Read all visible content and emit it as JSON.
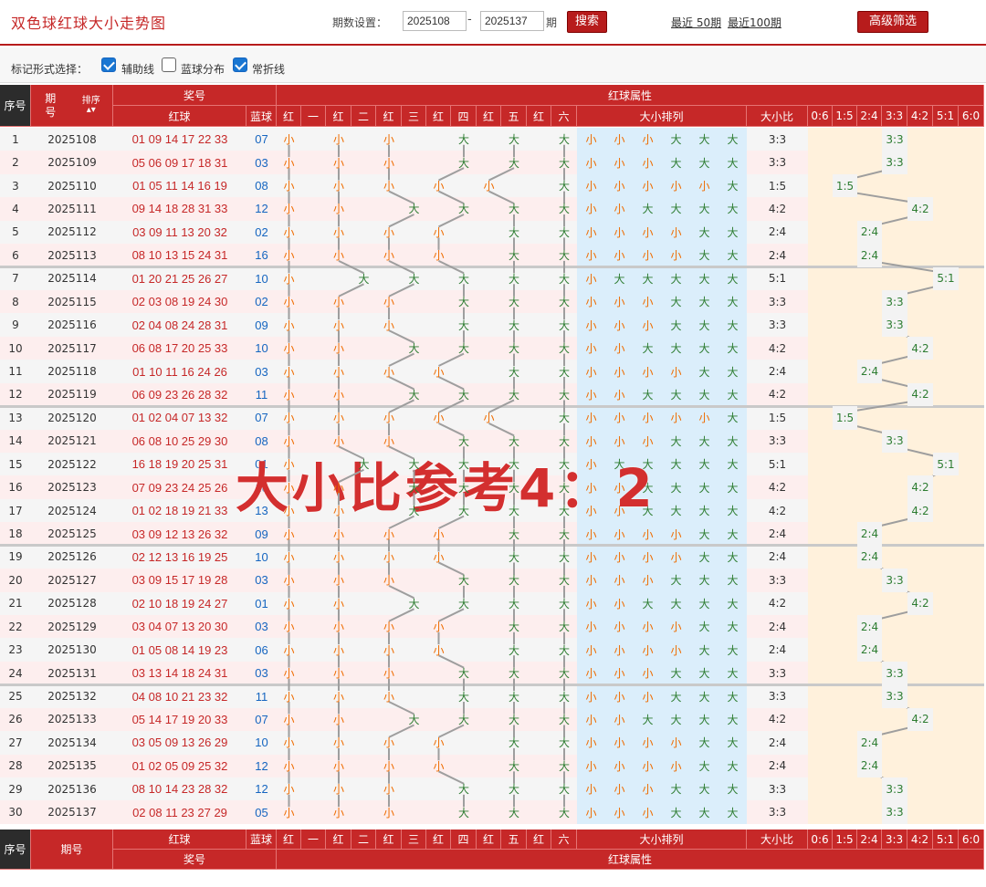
{
  "header": {
    "title": "双色球红球大小走势图",
    "period_setting_label": "期数设置：",
    "period_from": "2025108",
    "period_to": "2025137",
    "dash": "-",
    "period_unit": "期",
    "search_label": "搜索",
    "recent_50_label": "最近 50期",
    "recent_100_label": "最近100期",
    "advanced_filter_label": "高级筛选"
  },
  "mark_options": {
    "label": "标记形式选择：",
    "options": [
      {
        "label": "辅助线",
        "checked": true
      },
      {
        "label": "蓝球分布",
        "checked": false
      },
      {
        "label": "常折线",
        "checked": true
      }
    ]
  },
  "table_header": {
    "seq": "序号",
    "issue": "期号",
    "sort": "排序",
    "prize_no": "奖号",
    "red_ball": "红球",
    "blue_ball": "蓝球",
    "red_attr": "红球属性",
    "positions": [
      "红",
      "一",
      "红",
      "二",
      "红",
      "三",
      "红",
      "四",
      "红",
      "五",
      "红",
      "六"
    ],
    "size_arrangement": "大小排列",
    "size_ratio": "大小比",
    "ratio_columns": [
      "0:6",
      "1:5",
      "2:4",
      "3:3",
      "4:2",
      "5:1",
      "6:0"
    ]
  },
  "labels": {
    "small": "小",
    "big": "大"
  },
  "rows": [
    {
      "seq": "1",
      "issue": "2025108",
      "red": "01 09 14 17 22 33",
      "blue": "07",
      "pattern": "SSSBBB",
      "ratio": "3:3"
    },
    {
      "seq": "2",
      "issue": "2025109",
      "red": "05 06 09 17 18 31",
      "blue": "03",
      "pattern": "SSSBBB",
      "ratio": "3:3"
    },
    {
      "seq": "3",
      "issue": "2025110",
      "red": "01 05 11 14 16 19",
      "blue": "08",
      "pattern": "SSSSSB",
      "ratio": "1:5"
    },
    {
      "seq": "4",
      "issue": "2025111",
      "red": "09 14 18 28 31 33",
      "blue": "12",
      "pattern": "SSBBBB",
      "ratio": "4:2"
    },
    {
      "seq": "5",
      "issue": "2025112",
      "red": "03 09 11 13 20 32",
      "blue": "02",
      "pattern": "SSSSBB",
      "ratio": "2:4"
    },
    {
      "seq": "6",
      "issue": "2025113",
      "red": "08 10 13 15 24 31",
      "blue": "16",
      "pattern": "SSSSBB",
      "ratio": "2:4"
    },
    {
      "seq": "7",
      "issue": "2025114",
      "red": "01 20 21 25 26 27",
      "blue": "10",
      "pattern": "SBBBBB",
      "ratio": "5:1"
    },
    {
      "seq": "8",
      "issue": "2025115",
      "red": "02 03 08 19 24 30",
      "blue": "02",
      "pattern": "SSSBBB",
      "ratio": "3:3"
    },
    {
      "seq": "9",
      "issue": "2025116",
      "red": "02 04 08 24 28 31",
      "blue": "09",
      "pattern": "SSSBBB",
      "ratio": "3:3"
    },
    {
      "seq": "10",
      "issue": "2025117",
      "red": "06 08 17 20 25 33",
      "blue": "10",
      "pattern": "SSBBBB",
      "ratio": "4:2"
    },
    {
      "seq": "11",
      "issue": "2025118",
      "red": "01 10 11 16 24 26",
      "blue": "03",
      "pattern": "SSSSBB",
      "ratio": "2:4"
    },
    {
      "seq": "12",
      "issue": "2025119",
      "red": "06 09 23 26 28 32",
      "blue": "11",
      "pattern": "SSBBBB",
      "ratio": "4:2"
    },
    {
      "seq": "13",
      "issue": "2025120",
      "red": "01 02 04 07 13 32",
      "blue": "07",
      "pattern": "SSSSSB",
      "ratio": "1:5"
    },
    {
      "seq": "14",
      "issue": "2025121",
      "red": "06 08 10 25 29 30",
      "blue": "08",
      "pattern": "SSSBBB",
      "ratio": "3:3"
    },
    {
      "seq": "15",
      "issue": "2025122",
      "red": "16 18 19 20 25 31",
      "blue": "01",
      "pattern": "SBBBBB",
      "ratio": "5:1"
    },
    {
      "seq": "16",
      "issue": "2025123",
      "red": "07 09 23 24 25 26",
      "blue": "10",
      "pattern": "SSBBBB",
      "ratio": "4:2"
    },
    {
      "seq": "17",
      "issue": "2025124",
      "red": "01 02 18 19 21 33",
      "blue": "13",
      "pattern": "SSBBBB",
      "ratio": "4:2"
    },
    {
      "seq": "18",
      "issue": "2025125",
      "red": "03 09 12 13 26 32",
      "blue": "09",
      "pattern": "SSSSBB",
      "ratio": "2:4"
    },
    {
      "seq": "19",
      "issue": "2025126",
      "red": "02 12 13 16 19 25",
      "blue": "10",
      "pattern": "SSSSBB",
      "ratio": "2:4"
    },
    {
      "seq": "20",
      "issue": "2025127",
      "red": "03 09 15 17 19 28",
      "blue": "03",
      "pattern": "SSSBBB",
      "ratio": "3:3"
    },
    {
      "seq": "21",
      "issue": "2025128",
      "red": "02 10 18 19 24 27",
      "blue": "01",
      "pattern": "SSBBBB",
      "ratio": "4:2"
    },
    {
      "seq": "22",
      "issue": "2025129",
      "red": "03 04 07 13 20 30",
      "blue": "03",
      "pattern": "SSSSBB",
      "ratio": "2:4"
    },
    {
      "seq": "23",
      "issue": "2025130",
      "red": "01 05 08 14 19 23",
      "blue": "06",
      "pattern": "SSSSBB",
      "ratio": "2:4"
    },
    {
      "seq": "24",
      "issue": "2025131",
      "red": "03 13 14 18 24 31",
      "blue": "03",
      "pattern": "SSSBBB",
      "ratio": "3:3"
    },
    {
      "seq": "25",
      "issue": "2025132",
      "red": "04 08 10 21 23 32",
      "blue": "11",
      "pattern": "SSSBBB",
      "ratio": "3:3"
    },
    {
      "seq": "26",
      "issue": "2025133",
      "red": "05 14 17 19 20 33",
      "blue": "07",
      "pattern": "SSBBBB",
      "ratio": "4:2"
    },
    {
      "seq": "27",
      "issue": "2025134",
      "red": "03 05 09 13 26 29",
      "blue": "10",
      "pattern": "SSSSBB",
      "ratio": "2:4"
    },
    {
      "seq": "28",
      "issue": "2025135",
      "red": "01 02 05 09 25 32",
      "blue": "12",
      "pattern": "SSSSBB",
      "ratio": "2:4"
    },
    {
      "seq": "29",
      "issue": "2025136",
      "red": "08 10 14 23 28 32",
      "blue": "12",
      "pattern": "SSSBBB",
      "ratio": "3:3"
    },
    {
      "seq": "30",
      "issue": "2025137",
      "red": "02 08 11 23 27 29",
      "blue": "05",
      "pattern": "SSSBBB",
      "ratio": "3:3"
    }
  ],
  "watermark": "大小比参考4：2",
  "colors": {
    "header_red": "#c62828",
    "small_orange": "#ef6c00",
    "big_green": "#2e7d32",
    "red_number": "#c62828",
    "blue_number": "#1565c0",
    "arrangement_bg": "#dbeefb",
    "ratio_bg": "#fff1dc",
    "zebra_pink": "#fdeeee",
    "zebra_gray": "#f5f5f5"
  }
}
